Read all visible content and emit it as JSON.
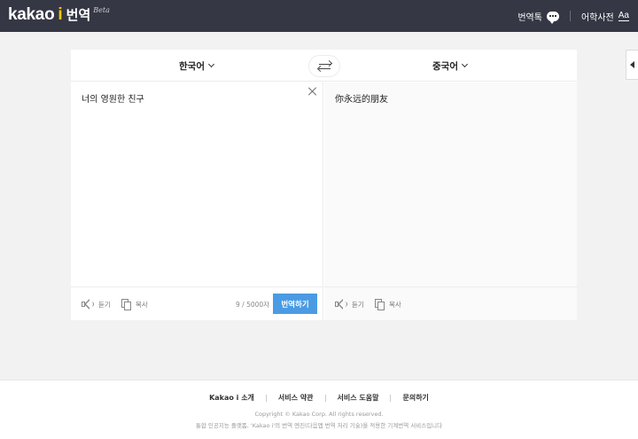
{
  "header": {
    "logo_kakao": "kakao",
    "logo_i": "i",
    "logo_service": "번역",
    "logo_beta": "Beta",
    "translation_talk": "번역톡",
    "dictionary": "어학사전",
    "dictionary_icon_text": "Aa"
  },
  "translator": {
    "source_language": "한국어",
    "target_language": "중국어",
    "source_text": "너의 영원한 친구",
    "target_text": "你永远的朋友",
    "listen_label": "듣기",
    "copy_label": "복사",
    "char_count": "9 / 5000자",
    "translate_button": "번역하기"
  },
  "footer": {
    "links": [
      "Kakao i 소개",
      "서비스 약관",
      "서비스 도움말",
      "문의하기"
    ],
    "copyright": "Copyright © Kakao Corp. All rights reserved.",
    "notice": "통합 인공지능 플랫폼, 'Kakao i'의 번역 엔진(다음앱 번역 처리 기술)을 적용한 기계번역 서비스입니다"
  },
  "colors": {
    "topbar": "#353744",
    "accent_yellow": "#f9c900",
    "translate_button": "#4a9be3",
    "page_background": "#f2f2f2"
  },
  "icons": [
    "chat-bubble-icon",
    "swap-arrows-icon",
    "close-icon",
    "speaker-icon",
    "copy-icon",
    "chevron-down-icon",
    "chevron-left-icon"
  ]
}
